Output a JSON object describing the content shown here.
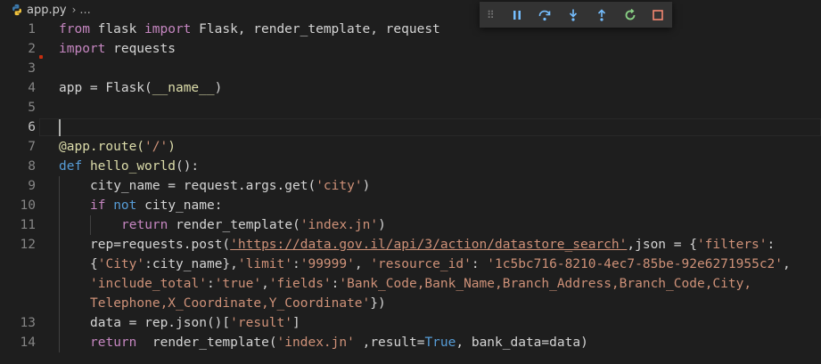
{
  "breadcrumb": {
    "file": "app.py",
    "separator": "›",
    "more": "..."
  },
  "debug_toolbar": {
    "buttons": [
      {
        "name": "pause-button",
        "icon": "pause-icon"
      },
      {
        "name": "step-over-button",
        "icon": "step-over-icon"
      },
      {
        "name": "step-into-button",
        "icon": "step-into-icon"
      },
      {
        "name": "step-out-button",
        "icon": "step-out-icon"
      },
      {
        "name": "restart-button",
        "icon": "restart-icon"
      },
      {
        "name": "stop-button",
        "icon": "stop-icon"
      }
    ],
    "colors": {
      "accent": "#75beff",
      "restart": "#89d185",
      "stop": "#f48771"
    }
  },
  "editor": {
    "active_line": 6,
    "lines": [
      {
        "num": "1"
      },
      {
        "num": "2"
      },
      {
        "num": "3"
      },
      {
        "num": "4"
      },
      {
        "num": "5"
      },
      {
        "num": "6"
      },
      {
        "num": "7"
      },
      {
        "num": "8"
      },
      {
        "num": "9"
      },
      {
        "num": "10"
      },
      {
        "num": "11"
      },
      {
        "num": "12"
      },
      {
        "num": ""
      },
      {
        "num": ""
      },
      {
        "num": ""
      },
      {
        "num": "13"
      },
      {
        "num": "14"
      }
    ],
    "tokens": {
      "l1": [
        "from",
        " flask ",
        "import",
        " Flask, render_template, request"
      ],
      "l2": [
        "import",
        " requests"
      ],
      "l4": [
        "app = ",
        "Flask",
        "(",
        "__name__",
        ")"
      ],
      "l7": [
        "@app.route(",
        "'/'",
        ")"
      ],
      "l8": [
        "def",
        " ",
        "hello_world",
        "():"
      ],
      "l9": [
        "city_name",
        " = request.args.",
        "get",
        "(",
        "'city'",
        ")"
      ],
      "l10": [
        "if",
        " ",
        "not",
        " city_name:"
      ],
      "l11": [
        "return",
        " ",
        "render_template",
        "(",
        "'index.jn'",
        ")"
      ],
      "l12": [
        "rep=requests.",
        "post",
        "(",
        "'https://data.gov.il/api/3/action/datastore_search'",
        ",",
        "json",
        " = {",
        "'filters'",
        ":"
      ],
      "l12b": [
        "{",
        "'City'",
        ":city_name},",
        "'limit'",
        ":",
        "'99999'",
        ", ",
        "'resource_id'",
        ": ",
        "'1c5bc716-8210-4ec7-85be-92e6271955c2'",
        ","
      ],
      "l12c": [
        "'include_total'",
        ":",
        "'true'",
        ",",
        "'fields'",
        ":",
        "'Bank_Code,Bank_Name,Branch_Address,Branch_Code,City,"
      ],
      "l12d": [
        "Telephone,X_Coordinate,Y_Coordinate'",
        "})"
      ],
      "l13": [
        "data",
        " = rep.",
        "json",
        "()[",
        "'result'",
        "]"
      ],
      "l14": [
        "return",
        "  ",
        "render_template",
        "(",
        "'index.jn'",
        " ,",
        "result",
        "=",
        "True",
        ", ",
        "bank_data",
        "=data)"
      ]
    }
  }
}
